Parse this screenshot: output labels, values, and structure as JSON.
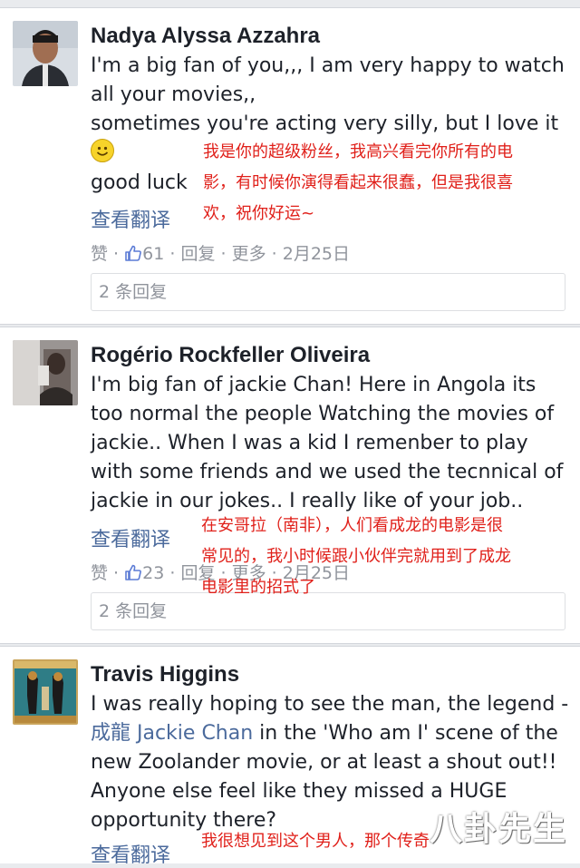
{
  "comments": [
    {
      "author": "Nadya Alyssa Azzahra",
      "lines": [
        "I'm a big fan of you,,, I am very happy to watch",
        "all your movies,,",
        "sometimes you're acting very silly, but I love it",
        "",
        "good luck"
      ],
      "emoji": "smile-emoji",
      "translate": "查看翻译",
      "meta": {
        "like": "赞",
        "like_count": "61",
        "reply": "回复",
        "more": "更多",
        "date": "2月25日",
        "sep": " · "
      },
      "replies": "2 条回复",
      "annotation": [
        "我是你的超级粉丝，我高兴看完你所有的电",
        "影，有时候你演得看起来很蠢，但是我很喜",
        "欢，祝你好运~"
      ]
    },
    {
      "author": "Rogério Rockfeller Oliveira",
      "lines": [
        "I'm big fan of jackie Chan! Here in Angola its",
        "too normal the people Watching the movies of",
        "jackie.. When I was a kid I remenber to play",
        "with some friends and we used the tecnnical of",
        "jackie in our jokes.. I really like of your job.."
      ],
      "translate": "查看翻译",
      "meta": {
        "like": "赞",
        "like_count": "23",
        "reply": "回复",
        "more": "更多",
        "date": "2月25日",
        "sep": " · "
      },
      "replies": "2 条回复",
      "annotation": [
        "在安哥拉（南非），人们看成龙的电影是很",
        "常见的，我小时候跟小伙伴完就用到了成龙",
        "电影里的招式了"
      ]
    },
    {
      "author": "Travis Higgins",
      "lines_pre": "I was really hoping to see the man, the legend -",
      "mention": "成龍 Jackie Chan",
      "mention_tail": " in the 'Who am I' scene of the",
      "lines": [
        "new Zoolander movie, or at least a shout out!!",
        "Anyone else feel like they missed a HUGE",
        "opportunity there?"
      ],
      "translate": "查看翻译",
      "annotation": [
        "我很想见到这个男人，那个传奇"
      ]
    }
  ],
  "watermark": "八卦先生",
  "colors": {
    "link": "#4b6a9c",
    "annotation": "#e0201a",
    "meta": "#90949c"
  }
}
